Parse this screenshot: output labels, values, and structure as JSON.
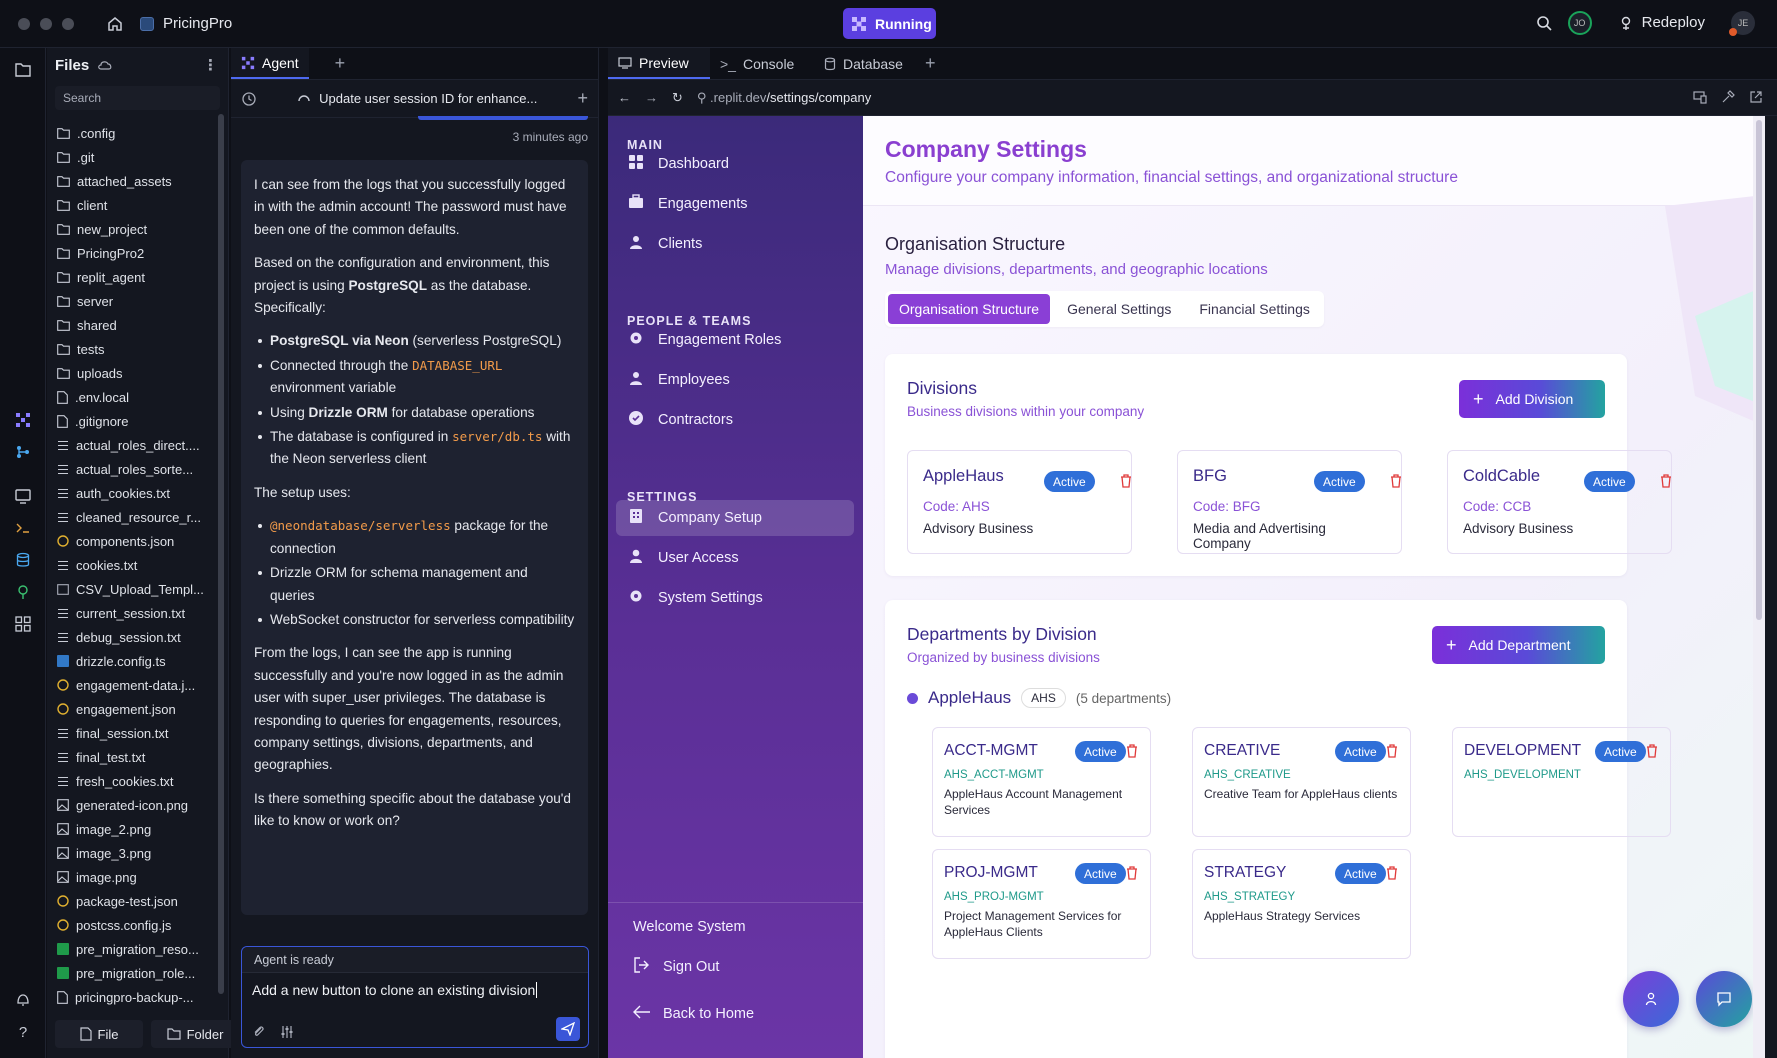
{
  "topbar": {
    "app_name": "PricingPro",
    "status": "Running",
    "user_initials": "JO",
    "redeploy_label": "Redeploy",
    "user2_initials": "JE"
  },
  "files": {
    "title": "Files",
    "search_placeholder": "Search",
    "items": [
      {
        "name": ".config",
        "type": "folder"
      },
      {
        "name": ".git",
        "type": "folder"
      },
      {
        "name": "attached_assets",
        "type": "folder"
      },
      {
        "name": "client",
        "type": "folder"
      },
      {
        "name": "new_project",
        "type": "folder"
      },
      {
        "name": "PricingPro2",
        "type": "folder"
      },
      {
        "name": "replit_agent",
        "type": "folder"
      },
      {
        "name": "server",
        "type": "folder"
      },
      {
        "name": "shared",
        "type": "folder"
      },
      {
        "name": "tests",
        "type": "folder"
      },
      {
        "name": "uploads",
        "type": "folder"
      },
      {
        "name": ".env.local",
        "type": "file"
      },
      {
        "name": ".gitignore",
        "type": "file"
      },
      {
        "name": "actual_roles_direct....",
        "type": "text"
      },
      {
        "name": "actual_roles_sorte...",
        "type": "text"
      },
      {
        "name": "auth_cookies.txt",
        "type": "text"
      },
      {
        "name": "cleaned_resource_r...",
        "type": "text"
      },
      {
        "name": "components.json",
        "type": "json"
      },
      {
        "name": "cookies.txt",
        "type": "text"
      },
      {
        "name": "CSV_Upload_Templ...",
        "type": "csv"
      },
      {
        "name": "current_session.txt",
        "type": "text"
      },
      {
        "name": "debug_session.txt",
        "type": "text"
      },
      {
        "name": "drizzle.config.ts",
        "type": "ts"
      },
      {
        "name": "engagement-data.j...",
        "type": "json"
      },
      {
        "name": "engagement.json",
        "type": "json"
      },
      {
        "name": "final_session.txt",
        "type": "text"
      },
      {
        "name": "final_test.txt",
        "type": "text"
      },
      {
        "name": "fresh_cookies.txt",
        "type": "text"
      },
      {
        "name": "generated-icon.png",
        "type": "image"
      },
      {
        "name": "image_2.png",
        "type": "image"
      },
      {
        "name": "image_3.png",
        "type": "image"
      },
      {
        "name": "image.png",
        "type": "image"
      },
      {
        "name": "package-test.json",
        "type": "json"
      },
      {
        "name": "postcss.config.js",
        "type": "js"
      },
      {
        "name": "pre_migration_reso...",
        "type": "sheet"
      },
      {
        "name": "pre_migration_role...",
        "type": "sheet"
      },
      {
        "name": "pricingpro-backup-...",
        "type": "file"
      }
    ],
    "file_button": "File",
    "folder_button": "Folder"
  },
  "agent": {
    "tab_label": "Agent",
    "thread_title": "Update user session ID for enhance...",
    "timestamp": "3 minutes ago",
    "p1": "I can see from the logs that you successfully logged in with the admin account! The password must have been one of the common defaults.",
    "p2_pre": "Based on the configuration and environment, this project is using ",
    "p2_bold": "PostgreSQL",
    "p2_post": " as the database. Specifically:",
    "b1_bold": "PostgreSQL via Neon",
    "b1_rest": " (serverless PostgreSQL)",
    "b2_pre": "Connected through the ",
    "b2_code": "DATABASE_URL",
    "b2_post": " environment variable",
    "b3_pre": "Using ",
    "b3_bold": "Drizzle ORM",
    "b3_post": " for database operations",
    "b4_pre": "The database is configured in ",
    "b4_code": "server/db.ts",
    "b4_post": " with the Neon serverless client",
    "p3": "The setup uses:",
    "c1_code": "@neondatabase/serverless",
    "c1_post": " package for the connection",
    "c2": "Drizzle ORM for schema management and queries",
    "c3": "WebSocket constructor for serverless compatibility",
    "p4": "From the logs, I can see the app is running successfully and you're now logged in as the admin user with super_user privileges. The database is responding to queries for engagements, resources, company settings, divisions, departments, and geographies.",
    "p5": "Is there something specific about the database you'd like to know or work on?",
    "status": "Agent is ready",
    "input_value": "Add a new button to clone an existing division"
  },
  "preview": {
    "tabs": [
      "Preview",
      "Console",
      "Database"
    ],
    "url_prefix": ".replit.dev",
    "url_path": "/settings/company"
  },
  "app": {
    "sidebar": {
      "main_label": "MAIN",
      "main_items": [
        "Dashboard",
        "Engagements",
        "Clients"
      ],
      "people_label": "PEOPLE & TEAMS",
      "people_items": [
        "Engagement Roles",
        "Employees",
        "Contractors"
      ],
      "settings_label": "SETTINGS",
      "settings_items": [
        "Company Setup",
        "User Access",
        "System Settings"
      ],
      "welcome": "Welcome System",
      "sign_out": "Sign Out",
      "back_home": "Back to Home"
    },
    "header": {
      "title": "Company Settings",
      "subtitle": "Configure your company information, financial settings, and organizational structure"
    },
    "org": {
      "title": "Organisation Structure",
      "subtitle": "Manage divisions, departments, and geographic locations",
      "tabs": [
        "Organisation Structure",
        "General Settings",
        "Financial Settings"
      ]
    },
    "divisions": {
      "title": "Divisions",
      "subtitle": "Business divisions within your company",
      "add_label": "Add Division",
      "items": [
        {
          "name": "AppleHaus",
          "status": "Active",
          "code": "Code: AHS",
          "desc": "Advisory Business"
        },
        {
          "name": "BFG",
          "status": "Active",
          "code": "Code: BFG",
          "desc": "Media and Advertising Company"
        },
        {
          "name": "ColdCable",
          "status": "Active",
          "code": "Code: CCB",
          "desc": "Advisory Business"
        }
      ]
    },
    "departments": {
      "title": "Departments by Division",
      "subtitle": "Organized by business divisions",
      "add_label": "Add Department",
      "group_name": "AppleHaus",
      "group_code": "AHS",
      "group_count": "(5 departments)",
      "items": [
        {
          "name": "ACCT-MGMT",
          "status": "Active",
          "code": "AHS_ACCT-MGMT",
          "desc": "AppleHaus Account Management Services"
        },
        {
          "name": "CREATIVE",
          "status": "Active",
          "code": "AHS_CREATIVE",
          "desc": "Creative Team for AppleHaus clients"
        },
        {
          "name": "DEVELOPMENT",
          "status": "Active",
          "code": "AHS_DEVELOPMENT",
          "desc": ""
        },
        {
          "name": "PROJ-MGMT",
          "status": "Active",
          "code": "AHS_PROJ-MGMT",
          "desc": "Project Management Services for AppleHaus Clients"
        },
        {
          "name": "STRATEGY",
          "status": "Active",
          "code": "AHS_STRATEGY",
          "desc": "AppleHaus Strategy Services"
        }
      ]
    }
  },
  "colors": {
    "accent": "#8a3fd6",
    "badge": "#2f6fd8",
    "sidebar_top": "#3b2a7a",
    "running": "#5b3fe0"
  }
}
